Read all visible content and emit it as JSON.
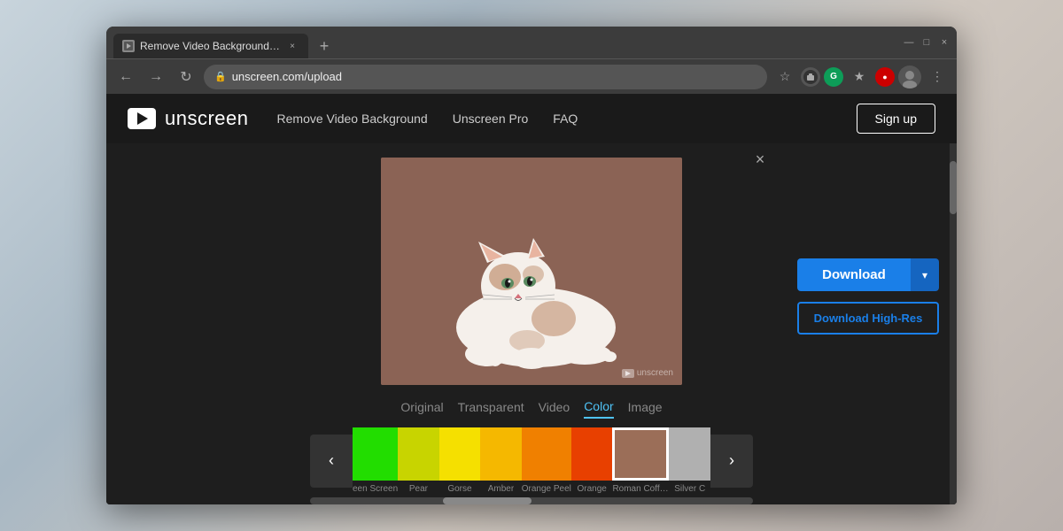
{
  "background": {
    "color": "#b0b8c0"
  },
  "browser": {
    "tab": {
      "title": "Remove Video Background – Un...",
      "close_label": "×"
    },
    "new_tab_label": "+",
    "window_controls": {
      "minimize": "—",
      "maximize": "□",
      "close": "×"
    },
    "nav": {
      "back": "←",
      "forward": "→",
      "refresh": "↻"
    },
    "url": "unscreen.com/upload",
    "lock_icon": "🔒"
  },
  "app": {
    "logo_text": "unscreen",
    "nav_links": [
      {
        "label": "Remove Video Background",
        "id": "nav-remove"
      },
      {
        "label": "Unscreen Pro",
        "id": "nav-pro"
      },
      {
        "label": "FAQ",
        "id": "nav-faq"
      }
    ],
    "signup_label": "Sign up",
    "close_label": "×"
  },
  "preview": {
    "tabs": [
      {
        "label": "Original",
        "active": false
      },
      {
        "label": "Transparent",
        "active": false
      },
      {
        "label": "Video",
        "active": false
      },
      {
        "label": "Color",
        "active": true
      },
      {
        "label": "Image",
        "active": false
      }
    ],
    "watermark": "⬛ unscreen"
  },
  "actions": {
    "download_label": "Download",
    "download_dropdown": "▾",
    "download_hires_label": "Download High-Res"
  },
  "swatches": [
    {
      "label": "een Screen",
      "color": "#22dd00",
      "selected": false
    },
    {
      "label": "Pear",
      "color": "#c8d400",
      "selected": false
    },
    {
      "label": "Gorse",
      "color": "#f5e000",
      "selected": false
    },
    {
      "label": "Amber",
      "color": "#f5b800",
      "selected": false
    },
    {
      "label": "Orange Peel",
      "color": "#f08000",
      "selected": false
    },
    {
      "label": "Orange",
      "color": "#e84000",
      "selected": false
    },
    {
      "label": "Roman Coffee",
      "color": "#9b6e58",
      "selected": true
    },
    {
      "label": "Silver C",
      "color": "#b0b0b0",
      "selected": false
    }
  ],
  "swatch_nav": {
    "left": "‹",
    "right": "›"
  }
}
